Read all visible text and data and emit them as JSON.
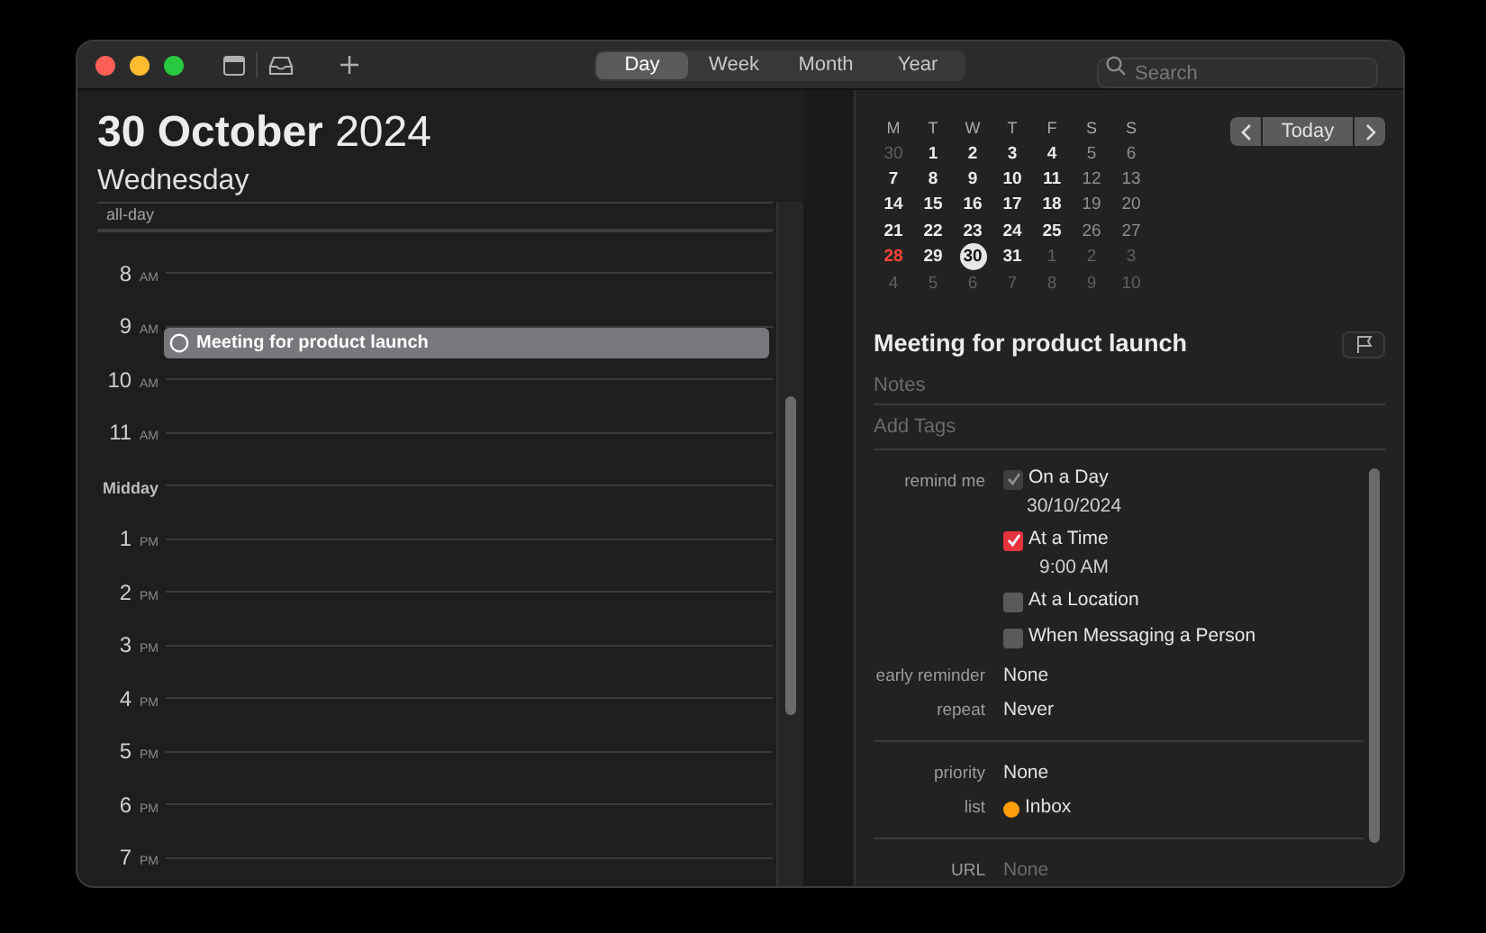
{
  "toolbar": {
    "views": [
      {
        "label": "Day",
        "selected": true
      },
      {
        "label": "Week",
        "selected": false
      },
      {
        "label": "Month",
        "selected": false
      },
      {
        "label": "Year",
        "selected": false
      }
    ],
    "search": {
      "placeholder": "Search"
    }
  },
  "day_header": {
    "date_bold": "30 October",
    "year": "2024",
    "weekday": "Wednesday"
  },
  "all_day_label": "all-day",
  "hours": [
    {
      "hour": "8",
      "period": "AM"
    },
    {
      "hour": "9",
      "period": "AM",
      "events": [
        {
          "title": "Meeting for product launch"
        }
      ]
    },
    {
      "hour": "10",
      "period": "AM"
    },
    {
      "hour": "11",
      "period": "AM"
    },
    {
      "hour": "Midday"
    },
    {
      "hour": "1",
      "period": "PM"
    },
    {
      "hour": "2",
      "period": "PM"
    },
    {
      "hour": "3",
      "period": "PM"
    },
    {
      "hour": "4",
      "period": "PM"
    },
    {
      "hour": "5",
      "period": "PM"
    },
    {
      "hour": "6",
      "period": "PM"
    },
    {
      "hour": "7",
      "period": "PM"
    }
  ],
  "mini_calendar": {
    "weekdays": [
      "M",
      "T",
      "W",
      "T",
      "F",
      "S",
      "S"
    ],
    "today_button": "Today",
    "days": [
      {
        "label": "30",
        "kind": "outside",
        "selected": false
      },
      {
        "label": "1",
        "kind": "weekday",
        "selected": false
      },
      {
        "label": "2",
        "kind": "weekday",
        "selected": false
      },
      {
        "label": "3",
        "kind": "weekday",
        "selected": false
      },
      {
        "label": "4",
        "kind": "weekday",
        "selected": false
      },
      {
        "label": "5",
        "kind": "weekend",
        "selected": false
      },
      {
        "label": "6",
        "kind": "weekend",
        "selected": false
      },
      {
        "label": "7",
        "kind": "weekday",
        "selected": false
      },
      {
        "label": "8",
        "kind": "weekday",
        "selected": false
      },
      {
        "label": "9",
        "kind": "weekday",
        "selected": false
      },
      {
        "label": "10",
        "kind": "weekday",
        "selected": false
      },
      {
        "label": "11",
        "kind": "weekday",
        "selected": false
      },
      {
        "label": "12",
        "kind": "weekend",
        "selected": false
      },
      {
        "label": "13",
        "kind": "weekend",
        "selected": false
      },
      {
        "label": "14",
        "kind": "weekday",
        "selected": false
      },
      {
        "label": "15",
        "kind": "weekday",
        "selected": false
      },
      {
        "label": "16",
        "kind": "weekday",
        "selected": false
      },
      {
        "label": "17",
        "kind": "weekday",
        "selected": false
      },
      {
        "label": "18",
        "kind": "weekday",
        "selected": false
      },
      {
        "label": "19",
        "kind": "weekend",
        "selected": false
      },
      {
        "label": "20",
        "kind": "weekend",
        "selected": false
      },
      {
        "label": "21",
        "kind": "weekday",
        "selected": false
      },
      {
        "label": "22",
        "kind": "weekday",
        "selected": false
      },
      {
        "label": "23",
        "kind": "weekday",
        "selected": false
      },
      {
        "label": "24",
        "kind": "weekday",
        "selected": false
      },
      {
        "label": "25",
        "kind": "weekday",
        "selected": false
      },
      {
        "label": "26",
        "kind": "weekend",
        "selected": false
      },
      {
        "label": "27",
        "kind": "weekend",
        "selected": false
      },
      {
        "label": "28",
        "kind": "holiday",
        "selected": false
      },
      {
        "label": "29",
        "kind": "weekday",
        "selected": false
      },
      {
        "label": "30",
        "kind": "weekday",
        "selected": true
      },
      {
        "label": "31",
        "kind": "weekday",
        "selected": false
      },
      {
        "label": "1",
        "kind": "outside",
        "selected": false
      },
      {
        "label": "2",
        "kind": "outside",
        "selected": false
      },
      {
        "label": "3",
        "kind": "outside",
        "selected": false
      },
      {
        "label": "4",
        "kind": "outside",
        "selected": false
      },
      {
        "label": "5",
        "kind": "outside",
        "selected": false
      },
      {
        "label": "6",
        "kind": "outside",
        "selected": false
      },
      {
        "label": "7",
        "kind": "outside",
        "selected": false
      },
      {
        "label": "8",
        "kind": "outside",
        "selected": false
      },
      {
        "label": "9",
        "kind": "outside",
        "selected": false
      },
      {
        "label": "10",
        "kind": "outside",
        "selected": false
      }
    ]
  },
  "detail": {
    "title": "Meeting for product launch",
    "notes_placeholder": "Notes",
    "tags_placeholder": "Add Tags",
    "remind_label": "remind me",
    "remind_options": [
      {
        "label": "On a Day",
        "checked": true,
        "disabled": true,
        "value": "30/10/2024"
      },
      {
        "label": "At a Time",
        "checked": true,
        "disabled": false,
        "value": "9:00 AM"
      },
      {
        "label": "At a Location",
        "checked": false
      },
      {
        "label": "When Messaging a Person",
        "checked": false
      }
    ],
    "groups": [
      [
        {
          "label": "early reminder",
          "value": "None"
        },
        {
          "label": "repeat",
          "value": "Never"
        }
      ],
      [
        {
          "label": "priority",
          "value": "None"
        },
        {
          "label": "list",
          "value": "Inbox",
          "color": "#ff9f0a"
        }
      ],
      [
        {
          "label": "URL",
          "placeholder": "None"
        }
      ]
    ]
  }
}
